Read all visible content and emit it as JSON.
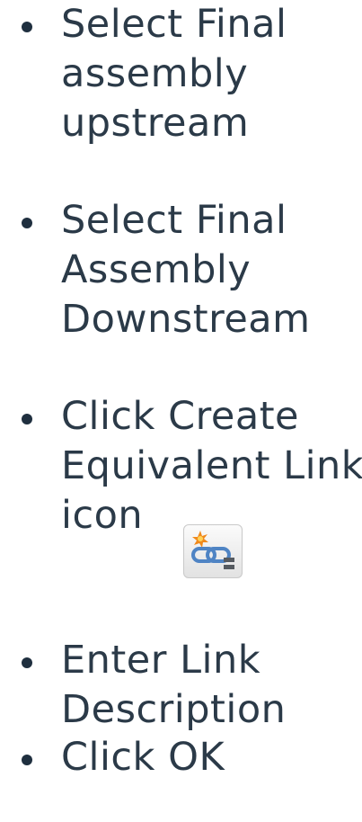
{
  "instructions": [
    {
      "lines": [
        "Select Final",
        "assembly",
        "upstream"
      ]
    },
    {
      "lines": [
        "Select Final",
        "Assembly",
        "Downstream"
      ]
    },
    {
      "lines": [
        "Click Create",
        "Equivalent Link",
        "icon"
      ]
    },
    {
      "lines": [
        "Enter Link",
        "Description"
      ]
    },
    {
      "lines": [
        "Click OK"
      ]
    }
  ],
  "icon": {
    "name": "create-equivalent-link-icon"
  },
  "colors": {
    "text": "#2b3a48",
    "bullet": "#1f2f3f",
    "icon_star": "#f08a1c",
    "icon_link": "#4f84c4"
  }
}
